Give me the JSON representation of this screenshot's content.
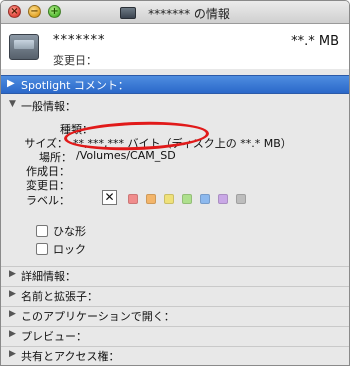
{
  "window": {
    "title": "******* の情報"
  },
  "header": {
    "file_name": "*******",
    "file_size": "**.* MB",
    "modified_label": "変更日："
  },
  "sections": {
    "spotlight": "Spotlight コメント：",
    "general": "一般情報：",
    "more_info": "詳細情報：",
    "name_ext": "名前と拡張子：",
    "open_with": "このアプリケーションで開く：",
    "preview": "プレビュー：",
    "sharing": "共有とアクセス権："
  },
  "general": {
    "kind_label": "種類：",
    "kind_value": "",
    "size_label": "サイズ：",
    "size_value": "**,***,*** バイト（ディスク上の **.* MB）",
    "where_label": "場所：",
    "where_value": "/Volumes/CAM_SD",
    "created_label": "作成日：",
    "modified_label": "変更日：",
    "label_label": "ラベル：",
    "label_colors": [
      "#f08c8c",
      "#f3b56a",
      "#efe17a",
      "#aee08d",
      "#8db9ee",
      "#c9a8e6",
      "#bdbdbd"
    ],
    "stationery_label": "ひな形",
    "locked_label": "ロック"
  },
  "highlight": {
    "color": "#e11a1a"
  }
}
